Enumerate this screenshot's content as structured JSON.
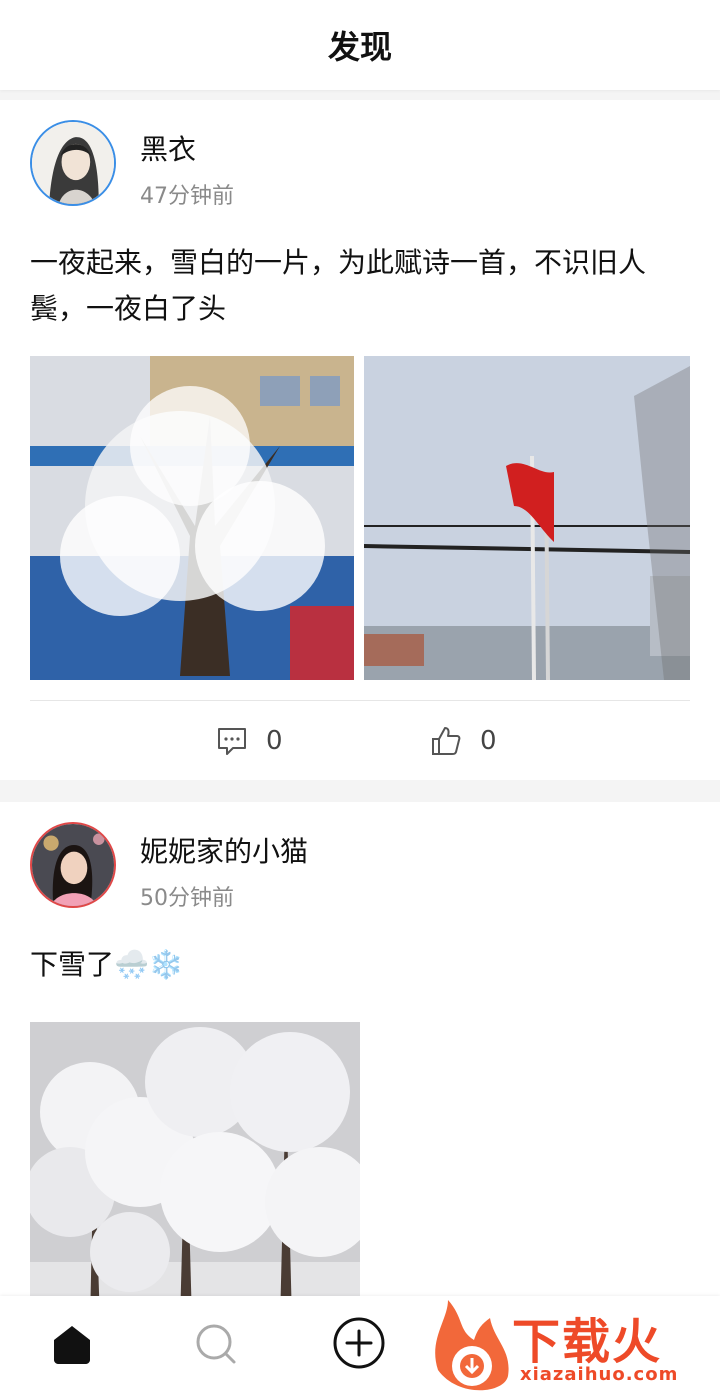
{
  "header": {
    "title": "发现"
  },
  "posts": [
    {
      "username": "黑衣",
      "time": "47分钟前",
      "text": "一夜起来，雪白的一片，为此赋诗一首，不识旧人鬓，一夜白了头",
      "comment_count": "0",
      "like_count": "0"
    },
    {
      "username": "妮妮家的小猫",
      "time": "50分钟前",
      "text": "下雪了🌨️❄️"
    }
  ],
  "tabbar": {
    "items": [
      {
        "icon": "home-icon",
        "active": true
      },
      {
        "icon": "search-icon",
        "active": false
      },
      {
        "icon": "add-icon",
        "active": false
      }
    ]
  },
  "watermark": {
    "text": "下载火",
    "url": "xiazaihuo.com"
  },
  "colors": {
    "accent_blue": "#3a8ee6",
    "accent_red": "#e04848",
    "watermark": "#ee4a28"
  }
}
